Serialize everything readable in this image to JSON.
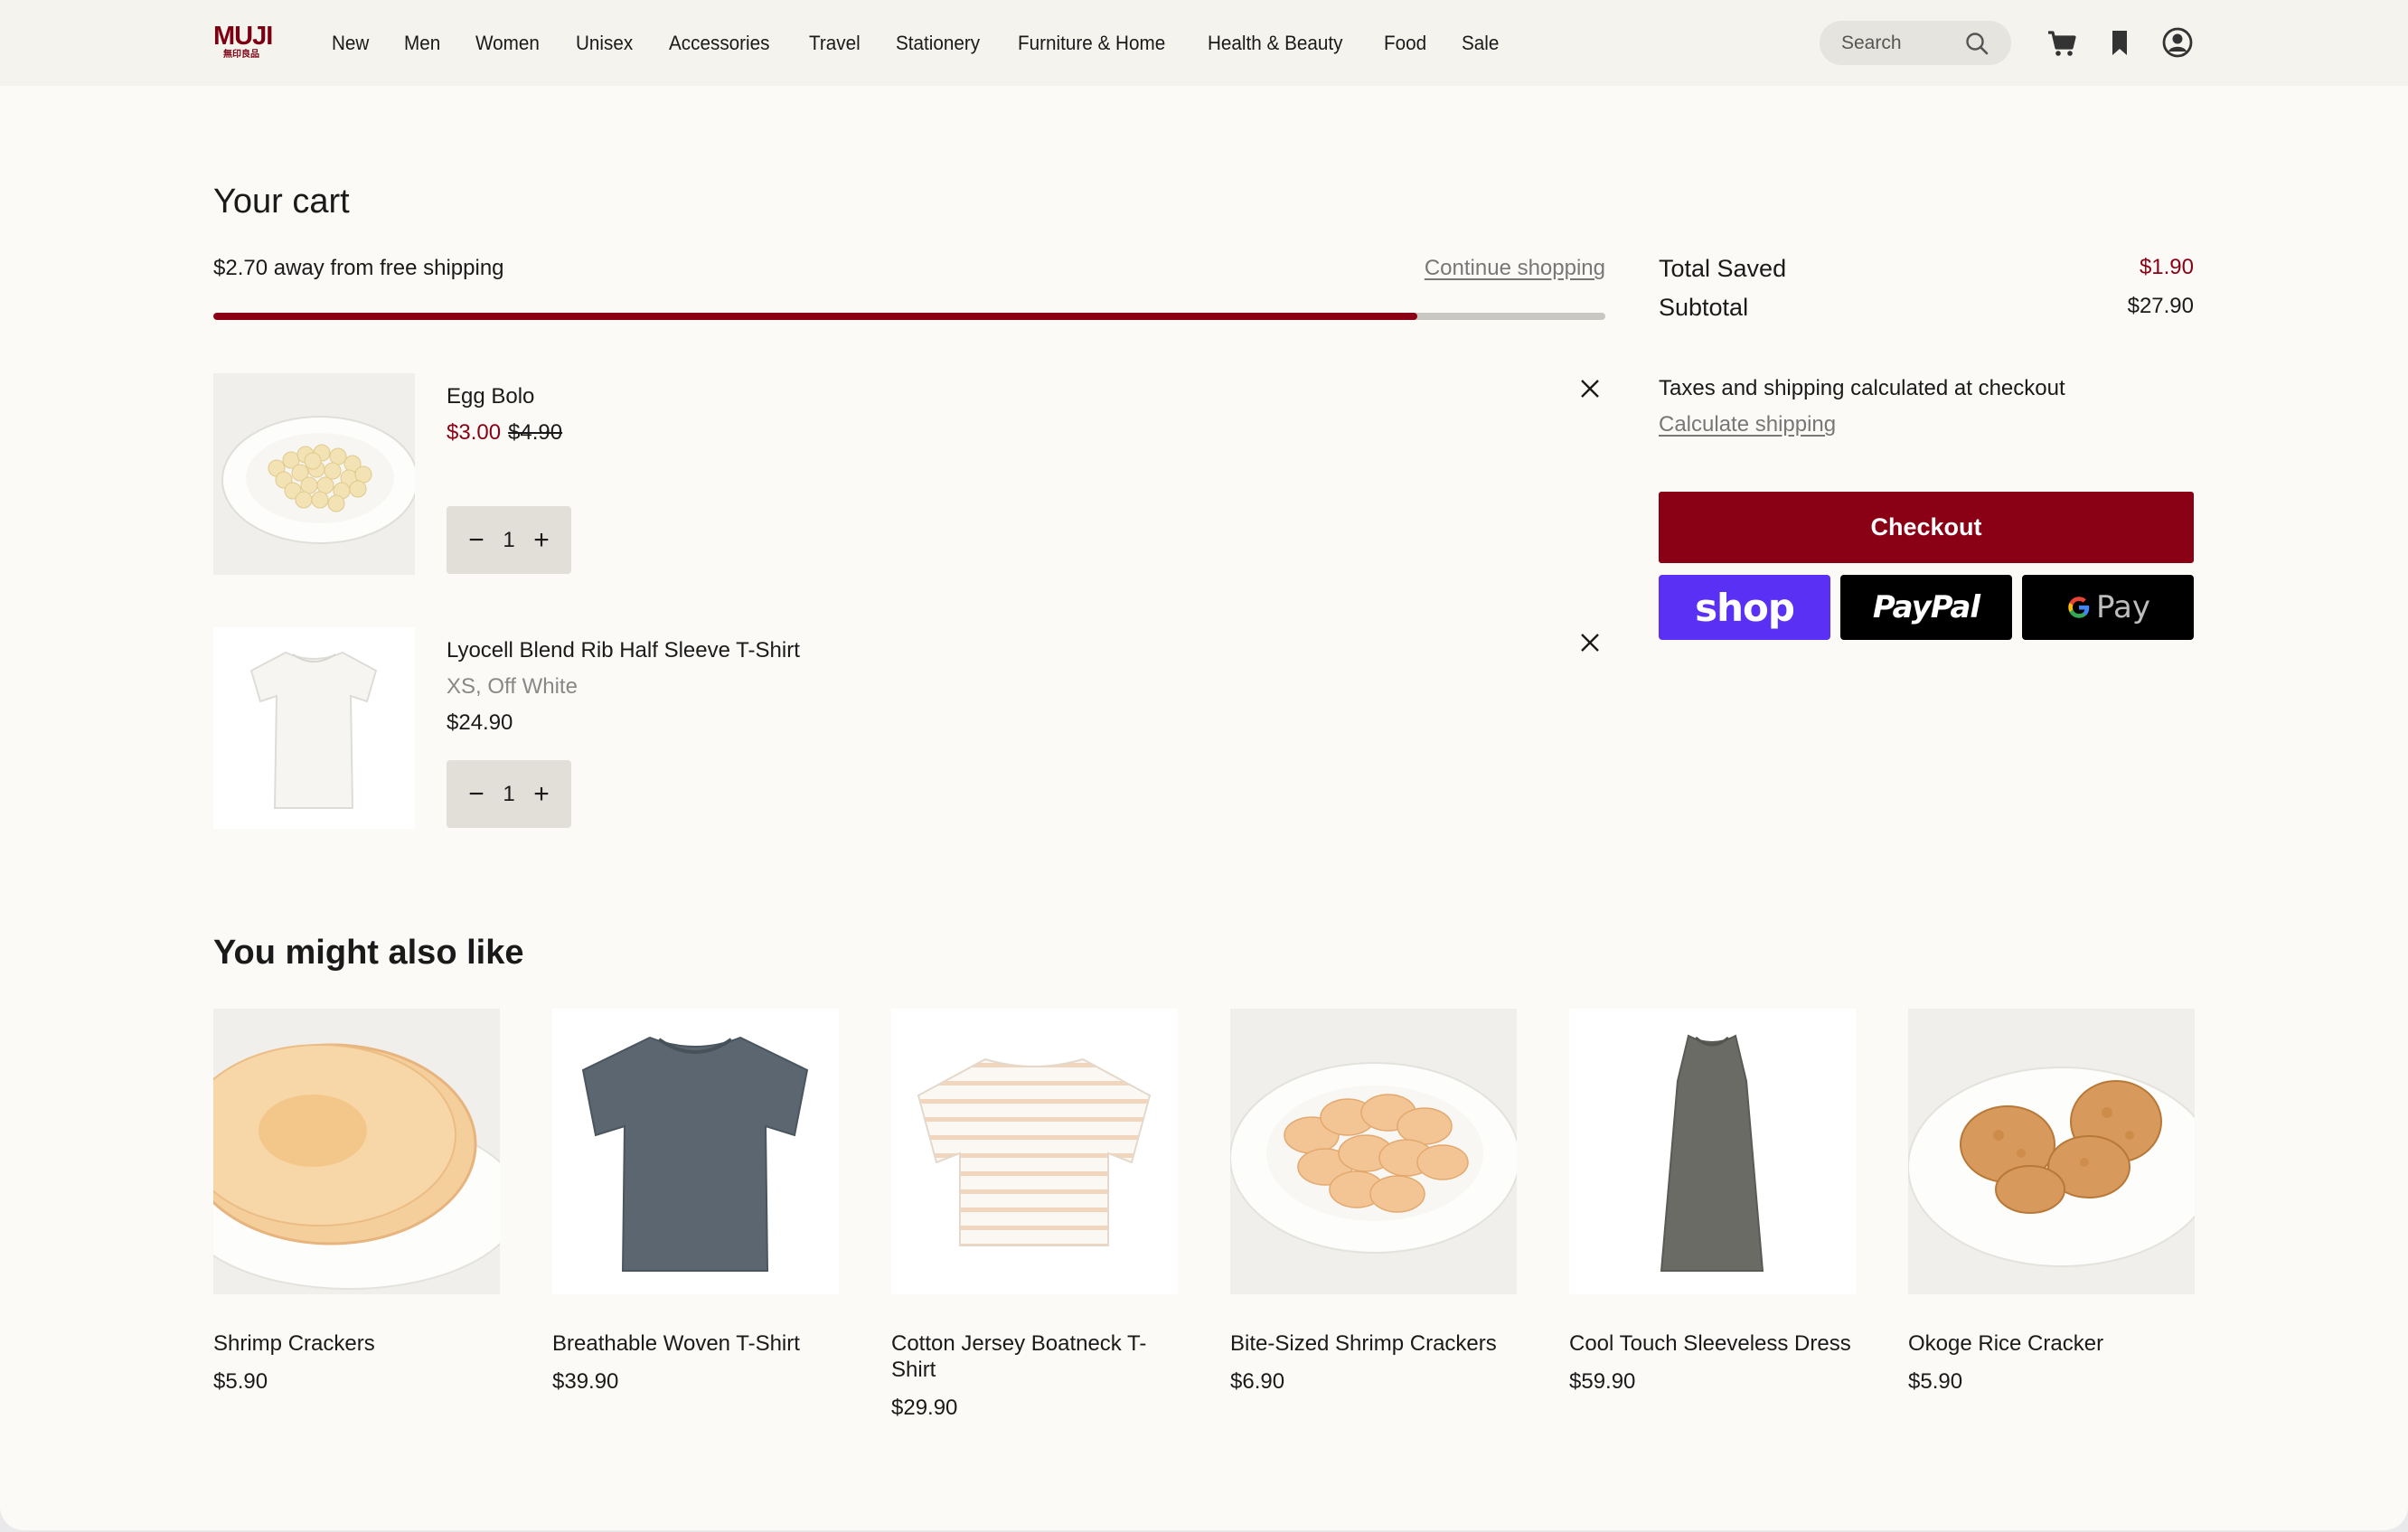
{
  "header": {
    "logo_main": "MUJI",
    "logo_sub": "無印良品",
    "nav": [
      "New",
      "Men",
      "Women",
      "Unisex",
      "Accessories",
      "Travel",
      "Stationery",
      "Furniture & Home",
      "Health & Beauty",
      "Food",
      "Sale"
    ],
    "search_placeholder": "Search",
    "icons": [
      "search-icon",
      "cart-icon",
      "bookmark-icon",
      "account-icon"
    ]
  },
  "cart": {
    "title": "Your cart",
    "free_shipping_text": "$2.70 away from free shipping",
    "free_shipping_progress": 0.865,
    "continue_label": "Continue shopping",
    "items": [
      {
        "name": "Egg Bolo",
        "sale_price": "$3.00",
        "original_price": "$4.90",
        "quantity": "1"
      },
      {
        "name": "Lyocell Blend Rib Half Sleeve T-Shirt",
        "variant": "XS, Off White",
        "price": "$24.90",
        "quantity": "1"
      }
    ],
    "qty_minus": "−",
    "qty_plus": "+"
  },
  "summary": {
    "saved_label": "Total Saved",
    "saved_value": "$1.90",
    "subtotal_label": "Subtotal",
    "subtotal_value": "$27.90",
    "tax_note": "Taxes and shipping calculated at checkout",
    "calc_shipping": "Calculate shipping",
    "checkout_label": "Checkout",
    "shop_pay": "shop",
    "paypal": "PayPal",
    "gpay": "Pay"
  },
  "recommendations": {
    "title": "You might also like",
    "items": [
      {
        "name": "Shrimp Crackers",
        "price": "$5.90"
      },
      {
        "name": "Breathable Woven T-Shirt",
        "price": "$39.90"
      },
      {
        "name": "Cotton Jersey Boatneck T-Shirt",
        "price": "$29.90"
      },
      {
        "name": "Bite-Sized Shrimp Crackers",
        "price": "$6.90"
      },
      {
        "name": "Cool Touch Sleeveless Dress",
        "price": "$59.90"
      },
      {
        "name": "Okoge Rice Cracker",
        "price": "$5.90"
      }
    ]
  },
  "colors": {
    "brand": "#8a0014",
    "shop_pay": "#5a31f4",
    "background": "#fbfaf7"
  }
}
